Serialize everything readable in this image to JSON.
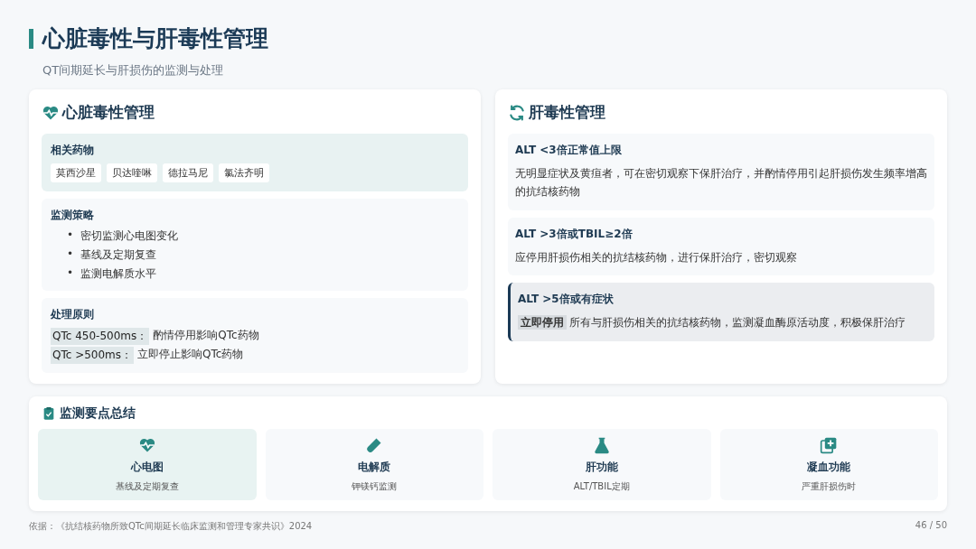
{
  "title": "心脏毒性与肝毒性管理",
  "subtitle": "QT间期延长与肝损伤的监测与处理",
  "cardiac": {
    "title": "心脏毒性管理",
    "drugs": {
      "heading": "相关药物",
      "items": [
        "莫西沙星",
        "贝达喹啉",
        "德拉马尼",
        "氯法齐明"
      ]
    },
    "strategy": {
      "heading": "监测策略",
      "items": [
        {
          "marker": "•",
          "text": "密切监测心电图变化"
        },
        {
          "marker": "•",
          "text": "基线及定期复查"
        },
        {
          "marker": "•",
          "text": "监测电解质水平"
        }
      ]
    },
    "principles": {
      "heading": "处理原则",
      "items": [
        {
          "tag": "QTc 450-500ms：",
          "text": "酌情停用影响QTc药物"
        },
        {
          "tag": "QTc >500ms：",
          "text": "立即停止影响QTc药物"
        }
      ]
    }
  },
  "liver": {
    "title": "肝毒性管理",
    "items": [
      {
        "kind": "normal",
        "heading": "ALT <3倍正常值上限",
        "text": "无明显症状及黄疸者，可在密切观察下保肝治疗，并酌情停用引起肝损伤发生频率增高的抗结核药物"
      },
      {
        "kind": "normal",
        "heading": "ALT >3倍或TBIL≥2倍",
        "text": "应停用肝损伤相关的抗结核药物，进行保肝治疗，密切观察"
      },
      {
        "kind": "alert",
        "heading": "ALT >5倍或有症状",
        "tag": "立即停用",
        "text": "所有与肝损伤相关的抗结核药物，监测凝血酶原活动度，积极保肝治疗"
      }
    ]
  },
  "summary": {
    "title": "监测要点总结",
    "items": [
      {
        "kind": "heart",
        "label": "心电图",
        "note": "基线及定期复查",
        "highlighted": true
      },
      {
        "kind": "tube",
        "label": "电解质",
        "note": "钾镁钙监测",
        "highlighted": false
      },
      {
        "kind": "flask",
        "label": "肝功能",
        "note": "ALT/TBIL定期",
        "highlighted": false
      },
      {
        "kind": "plus",
        "label": "凝血功能",
        "note": "严重肝损伤时",
        "highlighted": false
      }
    ]
  },
  "footer": {
    "source": "依据：《抗结核药物所致QTc间期延长临床监测和管理专家共识》2024",
    "page": "46 / 50"
  }
}
